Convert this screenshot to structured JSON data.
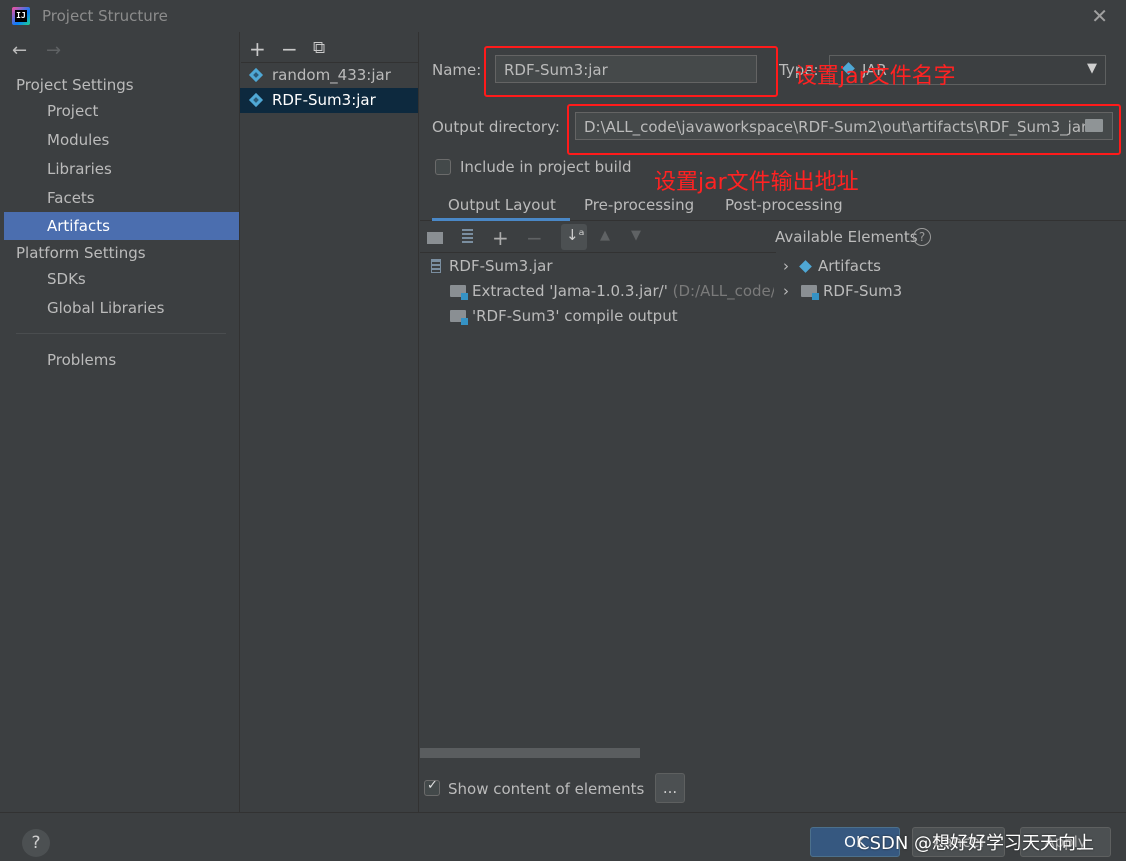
{
  "window": {
    "title": "Project Structure"
  },
  "nav": {
    "back_icon": "arrow-left",
    "forward_icon": "arrow-right",
    "project_settings_header": "Project Settings",
    "platform_settings_header": "Platform Settings",
    "items": [
      {
        "label": "Project"
      },
      {
        "label": "Modules"
      },
      {
        "label": "Libraries"
      },
      {
        "label": "Facets"
      },
      {
        "label": "Artifacts",
        "selected": true
      },
      {
        "label": "SDKs"
      },
      {
        "label": "Global Libraries"
      },
      {
        "label": "Problems"
      }
    ]
  },
  "artifacts": {
    "toolbar": {
      "add": "+",
      "remove": "−",
      "copy": "⧉"
    },
    "list": [
      {
        "label": "random_433:jar"
      },
      {
        "label": "RDF-Sum3:jar",
        "selected": true
      }
    ]
  },
  "form": {
    "name_label": "Name:",
    "name_value": "RDF-Sum3:jar",
    "type_label": "Type:",
    "type_value": "JAR",
    "output_dir_label": "Output directory:",
    "output_dir_value": "D:\\ALL_code\\javaworkspace\\RDF-Sum2\\out\\artifacts\\RDF_Sum3_jar",
    "include_build_label": "Include in project build",
    "include_build_checked": false
  },
  "annotations": {
    "name_note": "设置jar文件名字",
    "output_note": "设置jar文件输出地址"
  },
  "tabs": [
    {
      "label": "Output Layout",
      "active": true
    },
    {
      "label": "Pre-processing"
    },
    {
      "label": "Post-processing"
    }
  ],
  "output_layout": {
    "tree": [
      {
        "label": "RDF-Sum3.jar",
        "icon": "jar-icon"
      },
      {
        "label": "Extracted 'Jama-1.0.3.jar/'",
        "hint": "(D:/ALL_code/ja",
        "icon": "extract-icon"
      },
      {
        "label": "'RDF-Sum3' compile output",
        "icon": "module-output-icon"
      }
    ],
    "available_header": "Available Elements",
    "available": [
      {
        "label": "Artifacts"
      },
      {
        "label": "RDF-Sum3"
      }
    ],
    "show_content_label": "Show content of elements",
    "show_content_checked": true,
    "more_button": "..."
  },
  "footer": {
    "help": "?",
    "ok": "OK",
    "cancel": "Cancel",
    "apply": "Apply",
    "watermark": "CSDN @想好好学习天天向上"
  },
  "colors": {
    "background": "#3c3f41",
    "selection": "#4b6eaf",
    "annotation": "#ff1a1a",
    "ok_button": "#365880"
  }
}
